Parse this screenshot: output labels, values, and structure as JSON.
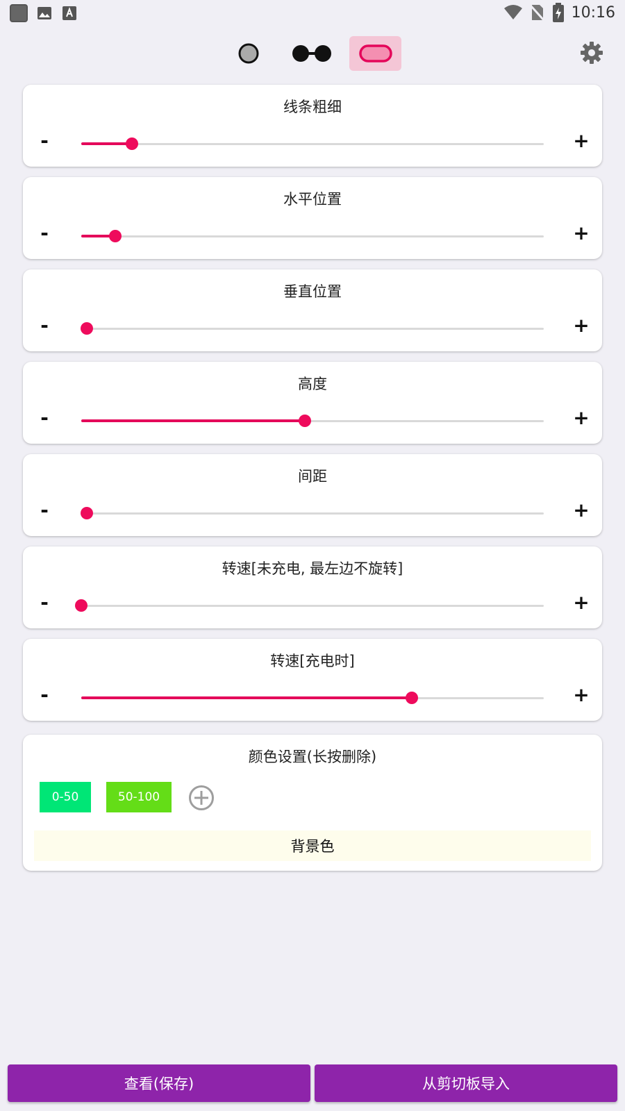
{
  "status_bar": {
    "time": "10:16",
    "left_icons": [
      "app-square-icon",
      "image-icon",
      "font-icon"
    ],
    "right_icons": [
      "wifi-icon",
      "no-sim-icon",
      "battery-charging-icon"
    ]
  },
  "toolbar": {
    "modes": [
      {
        "name": "circle",
        "icon": "circle-mode-icon",
        "selected": false
      },
      {
        "name": "dual-circle",
        "icon": "dual-circle-mode-icon",
        "selected": false
      },
      {
        "name": "capsule",
        "icon": "capsule-mode-icon",
        "selected": true
      }
    ],
    "settings_icon": "gear-icon"
  },
  "sliders": [
    {
      "title": "线条粗细",
      "value": 0.11
    },
    {
      "title": "水平位置",
      "value": 0.073
    },
    {
      "title": "垂直位置",
      "value": 0.012
    },
    {
      "title": "高度",
      "value": 0.483
    },
    {
      "title": "间距",
      "value": 0.012
    },
    {
      "title": "转速[未充电, 最左边不旋转]",
      "value": 0.0
    },
    {
      "title": "转速[充电时]",
      "value": 0.714
    }
  ],
  "minus_label": "-",
  "plus_label": "+",
  "color_settings": {
    "title": "颜色设置(长按删除)",
    "chips": [
      {
        "label": "0-50",
        "color": "#00e676"
      },
      {
        "label": "50-100",
        "color": "#64dd17"
      }
    ],
    "add_icon": "add-circle-icon",
    "background_label": "背景色"
  },
  "colors": {
    "accent": "#e4075a",
    "primary": "#8e24aa",
    "selected_mode_bg": "#f4c6d6"
  },
  "buttons": {
    "view_save": "查看(保存)",
    "import_clipboard": "从剪切板导入"
  }
}
